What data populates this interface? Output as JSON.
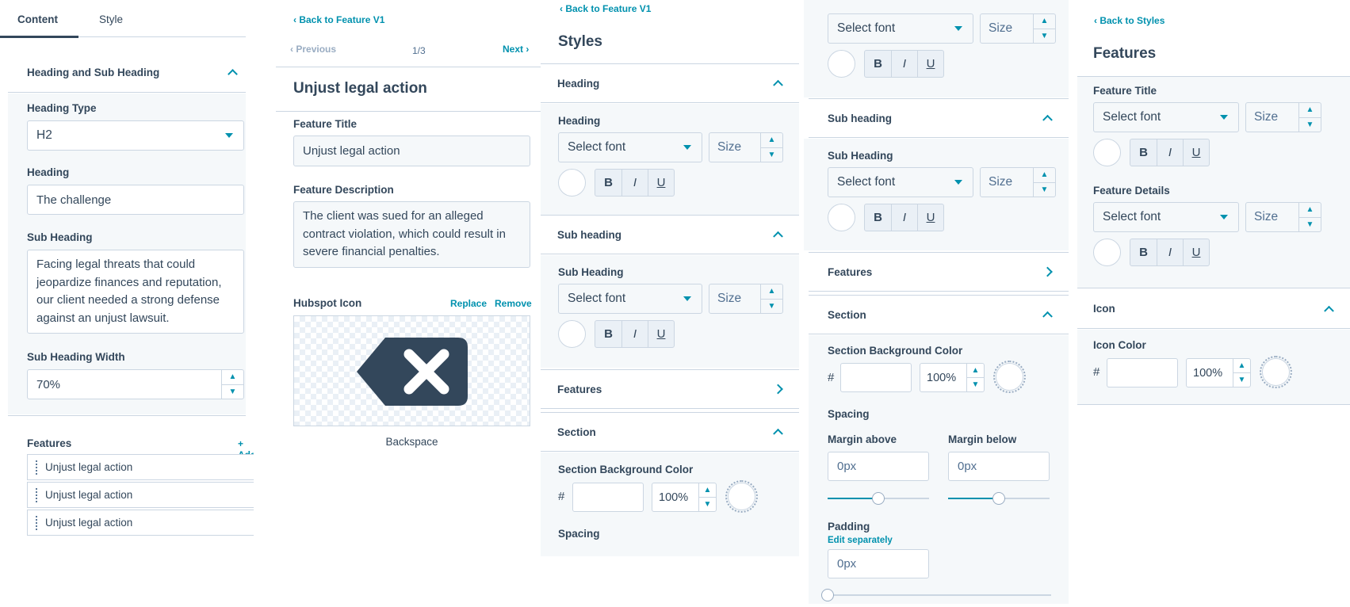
{
  "colors": {
    "accent": "#0091ae",
    "text": "#33475b",
    "border": "#cbd6e2",
    "panel_bg": "#f5f8fa",
    "icon_dark": "#33475b"
  },
  "content_panel": {
    "tabs": [
      {
        "label": "Content",
        "active": true
      },
      {
        "label": "Style",
        "active": false
      }
    ],
    "section_title": "Heading and Sub Heading",
    "heading_type_label": "Heading Type",
    "heading_type_value": "H2",
    "heading_label": "Heading",
    "heading_value": "The challenge",
    "subheading_label": "Sub Heading",
    "subheading_value": "Facing legal threats that could jeopardize finances and reputation, our client needed a strong defense against an unjust lawsuit.",
    "subheading_width_label": "Sub Heading Width",
    "subheading_width_value": "70%",
    "features_label": "Features",
    "add_label": "+ Add",
    "features": [
      "Unjust legal action",
      "Unjust legal action",
      "Unjust legal action"
    ]
  },
  "feature_panel": {
    "back_label": "Back to Feature V1",
    "prev_label": "Previous",
    "counter": "1/3",
    "next_label": "Next",
    "title": "Unjust legal action",
    "feature_title_label": "Feature Title",
    "feature_title_value": "Unjust legal action",
    "feature_desc_label": "Feature Description",
    "feature_desc_value": "The client was sued for an alleged contract violation, which could result in severe financial penalties.",
    "icon_label": "Hubspot Icon",
    "replace_label": "Replace",
    "remove_label": "Remove",
    "icon_name": "backspace-icon",
    "icon_caption": "Backspace"
  },
  "styles_panel": {
    "back_label": "Back to Feature V1",
    "title": "Styles",
    "sections": {
      "heading": "Heading",
      "subheading": "Sub heading",
      "features": "Features",
      "section": "Section"
    },
    "heading_field": "Heading",
    "subheading_field": "Sub Heading",
    "font_placeholder": "Select font",
    "size_placeholder": "Size",
    "bold": "B",
    "italic": "I",
    "underline": "U",
    "bg_color_label": "Section Background Color",
    "hash": "#",
    "opacity": "100%",
    "spacing_label": "Spacing"
  },
  "styles_panel_scrolled": {
    "font_placeholder": "Select font",
    "size_placeholder": "Size",
    "bold": "B",
    "italic": "I",
    "underline": "U",
    "subheading_section": "Sub heading",
    "subheading_field": "Sub Heading",
    "features_section": "Features",
    "section_section": "Section",
    "bg_color_label": "Section Background Color",
    "hash": "#",
    "opacity": "100%",
    "spacing_label": "Spacing",
    "margin_above_label": "Margin above",
    "margin_below_label": "Margin below",
    "margin_above_value": "0px",
    "margin_below_value": "0px",
    "padding_label": "Padding",
    "edit_separately_label": "Edit separately",
    "padding_value": "0px"
  },
  "features_style_panel": {
    "back_label": "Back to Styles",
    "title": "Features",
    "feature_title_label": "Feature Title",
    "feature_details_label": "Feature Details",
    "font_placeholder": "Select font",
    "size_placeholder": "Size",
    "bold": "B",
    "italic": "I",
    "underline": "U",
    "icon_section": "Icon",
    "icon_color_label": "Icon Color",
    "hash": "#",
    "opacity": "100%"
  }
}
